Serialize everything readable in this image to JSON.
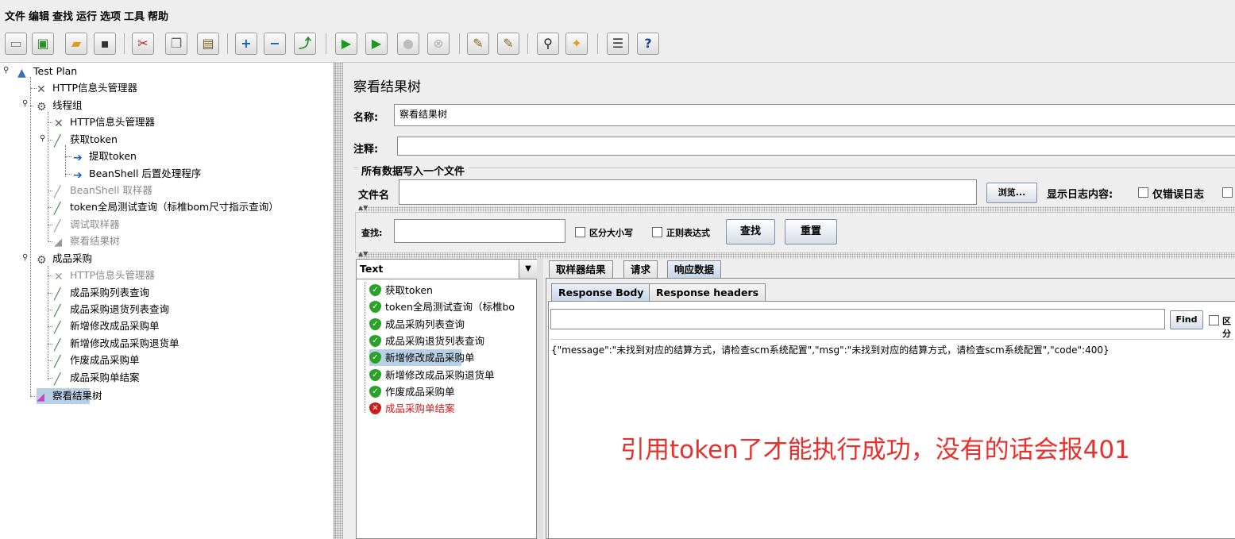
{
  "menu": [
    "文件",
    "编辑",
    "查找",
    "运行",
    "选项",
    "工具",
    "帮助"
  ],
  "toolbar_icons": [
    "new-icon",
    "templates-icon",
    "open-icon",
    "save-icon",
    "cut-icon",
    "copy-icon",
    "paste-icon",
    "expand-icon",
    "collapse-icon",
    "toggle-icon",
    "start-icon",
    "start-no-pause-icon",
    "stop-icon",
    "shutdown-icon",
    "clear-icon",
    "clear-all-icon",
    "search-icon",
    "reset-search-icon",
    "function-helper-icon",
    "help-icon"
  ],
  "tree": {
    "root": "Test Plan",
    "http_header_1": "HTTP信息头管理器",
    "thread_group": "线程组",
    "http_header_2": "HTTP信息头管理器",
    "get_token": "获取token",
    "extract_token": "提取token",
    "beanshell_post": "BeanShell 后置处理程序",
    "beanshell_sampler": "BeanShell 取样器",
    "token_query": "token全局测试查询（标椎bom尺寸指示查询）",
    "debug_sampler": "调试取样器",
    "result_tree_disabled": "察看结果树",
    "purchase_group": "成品采购",
    "http_header_3": "HTTP信息头管理器",
    "purchase_list": "成品采购列表查询",
    "purchase_return_list": "成品采购退货列表查询",
    "add_purchase": "新增修改成品采购单",
    "add_purchase_return": "新增修改成品采购退货单",
    "void_purchase": "作废成品采购单",
    "close_purchase": "成品采购单结案",
    "result_tree": "察看结果树"
  },
  "panel": {
    "title": "察看结果树",
    "name_label": "名称:",
    "name_value": "察看结果树",
    "comment_label": "注释:",
    "comment_value": "",
    "section_title": "所有数据写入一个文件",
    "filename_label": "文件名",
    "filename_value": "",
    "browse_button": "浏览...",
    "log_label": "显示日志内容:",
    "errors_only": "仅错误日志",
    "search_label": "查找:",
    "search_value": "",
    "case_sensitive": "区分大小写",
    "regex": "正则表达式",
    "find_button": "查找",
    "reset_button": "重置",
    "renderer": "Text",
    "results": [
      {
        "label": "获取token",
        "status": "ok"
      },
      {
        "label": "token全局测试查询（标椎bo",
        "status": "ok"
      },
      {
        "label": "成品采购列表查询",
        "status": "ok"
      },
      {
        "label": "成品采购退货列表查询",
        "status": "ok"
      },
      {
        "label": "新增修改成品采购单",
        "status": "ok"
      },
      {
        "label": "新增修改成品采购退货单",
        "status": "ok"
      },
      {
        "label": "作废成品采购单",
        "status": "ok"
      },
      {
        "label": "成品采购单结案",
        "status": "error"
      }
    ],
    "tabs": [
      "取样器结果",
      "请求",
      "响应数据"
    ],
    "subtabs": [
      "Response Body",
      "Response headers"
    ],
    "find_small": "Find",
    "find_small_case": "区分",
    "response_text": "{\"message\":\"未找到对应的结算方式，请检查scm系统配置\",\"msg\":\"未找到对应的结算方式，请检查scm系统配置\",\"code\":400}",
    "annotation": "引用token了才能执行成功，没有的话会报401"
  },
  "colors": {
    "annotation": "#e8312d",
    "error_text": "#d01818",
    "selection": "#b8cfe5"
  }
}
